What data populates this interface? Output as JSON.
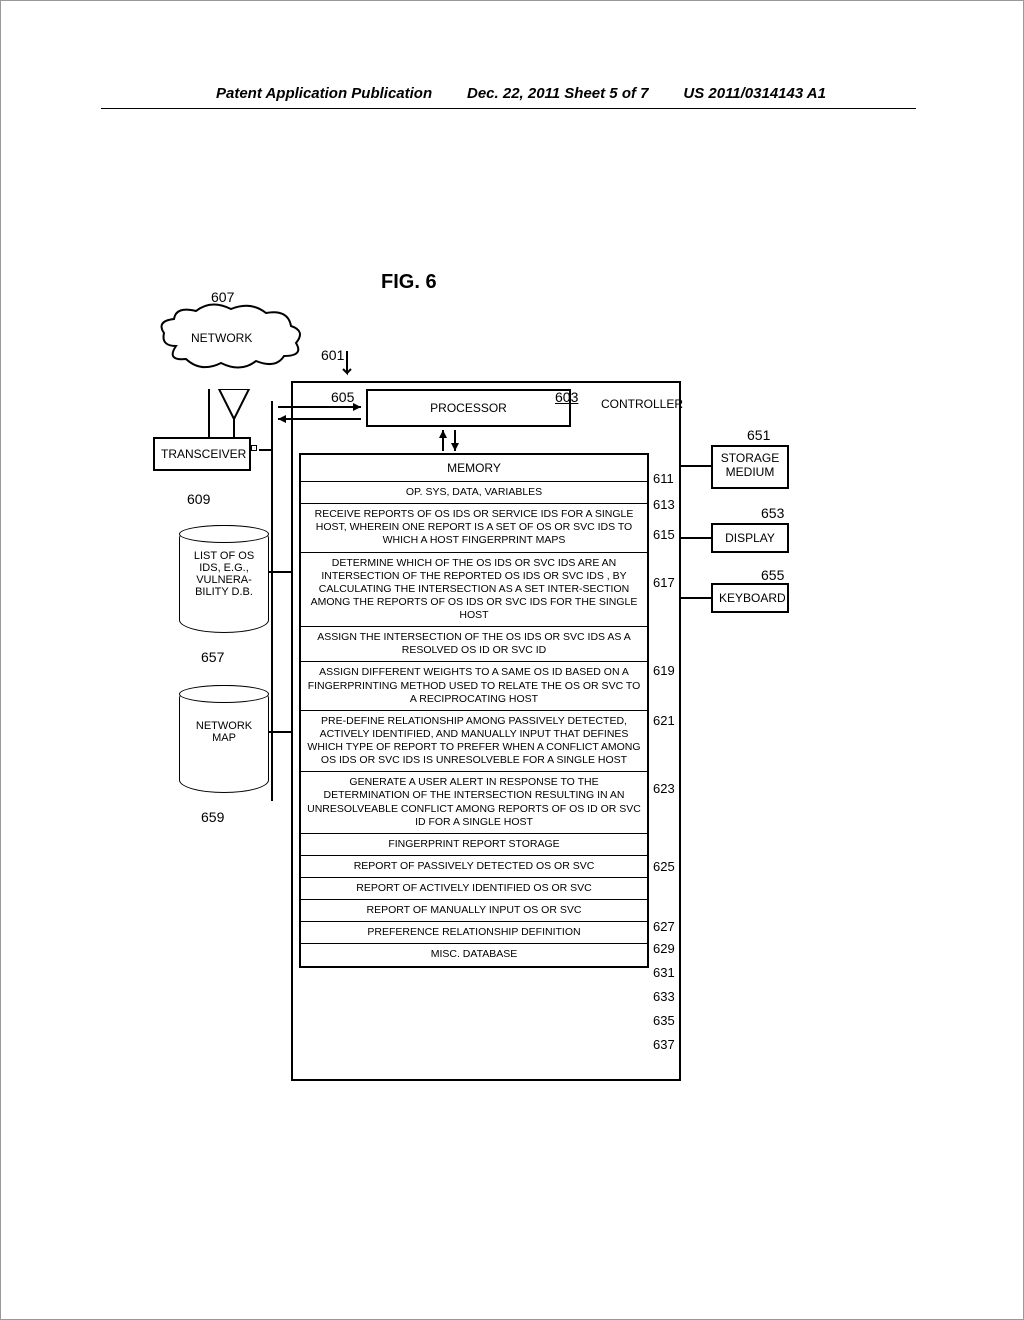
{
  "header": {
    "left": "Patent Application Publication",
    "center": "Dec. 22, 2011  Sheet 5 of 7",
    "right": "US 2011/0314143 A1"
  },
  "figure": {
    "title": "FIG. 6",
    "refs": {
      "r601": "601",
      "r603": "603",
      "r605": "605",
      "r607": "607",
      "r609": "609",
      "r611": "611",
      "r613": "613",
      "r615": "615",
      "r617": "617",
      "r619": "619",
      "r621": "621",
      "r623": "623",
      "r625": "625",
      "r627": "627",
      "r629": "629",
      "r631": "631",
      "r633": "633",
      "r635": "635",
      "r637": "637",
      "r651": "651",
      "r653": "653",
      "r655": "655",
      "r657": "657",
      "r659": "659"
    },
    "network_label": "NETWORK",
    "transceiver_label": "TRANSCEIVER",
    "controller_label": "CONTROLLER",
    "processor_label": "PROCESSOR",
    "memory_label": "MEMORY",
    "os_db_label": "LIST OF OS IDS, E.G., VULNERA-BILITY D.B.",
    "nm_db_label": "NETWORK MAP",
    "storage_label": "STORAGE MEDIUM",
    "display_label": "DISPLAY",
    "keyboard_label": "KEYBOARD",
    "memory_rows": {
      "r0": "OP. SYS, DATA, VARIABLES",
      "r1": "RECEIVE REPORTS OF OS IDS OR SERVICE IDS FOR A SINGLE HOST,  WHEREIN  ONE REPORT IS A SET OF OS OR SVC IDS TO WHICH A HOST FINGERPRINT MAPS",
      "r2": "DETERMINE WHICH OF THE OS  IDS OR SVC IDS ARE AN INTERSECTION OF THE REPORTED OS IDS OR SVC IDS , BY CALCULATING THE INTERSECTION AS A SET INTER-SECTION  AMONG THE REPORTS OF OS IDS OR SVC IDS FOR THE SINGLE HOST",
      "r3": "ASSIGN THE INTERSECTION OF THE OS IDS OR SVC IDS AS A RESOLVED OS ID OR SVC ID",
      "r4": "ASSIGN DIFFERENT WEIGHTS TO A SAME OS ID BASED ON A FINGERPRINTING METHOD USED TO RELATE THE OS OR SVC TO A RECIPROCATING HOST",
      "r5": "PRE-DEFINE RELATIONSHIP AMONG PASSIVELY DETECTED, ACTIVELY IDENTIFIED, AND MANUALLY INPUT THAT DEFINES WHICH TYPE OF REPORT TO PREFER WHEN A CONFLICT AMONG OS IDS OR SVC IDS IS UNRESOLVEBLE FOR A SINGLE HOST",
      "r6": "GENERATE A USER ALERT IN RESPONSE TO THE DETERMINATION OF THE INTERSECTION RESULTING IN AN UNRESOLVEABLE CONFLICT AMONG REPORTS OF OS ID OR SVC ID FOR A SINGLE HOST",
      "r7": "FINGERPRINT REPORT STORAGE",
      "r8": "REPORT OF PASSIVELY DETECTED OS OR SVC",
      "r9": "REPORT OF ACTIVELY IDENTIFIED OS OR SVC",
      "r10": "REPORT OF MANUALLY INPUT OS OR SVC",
      "r11": "PREFERENCE RELATIONSHIP DEFINITION",
      "r12": "MISC. DATABASE"
    }
  }
}
